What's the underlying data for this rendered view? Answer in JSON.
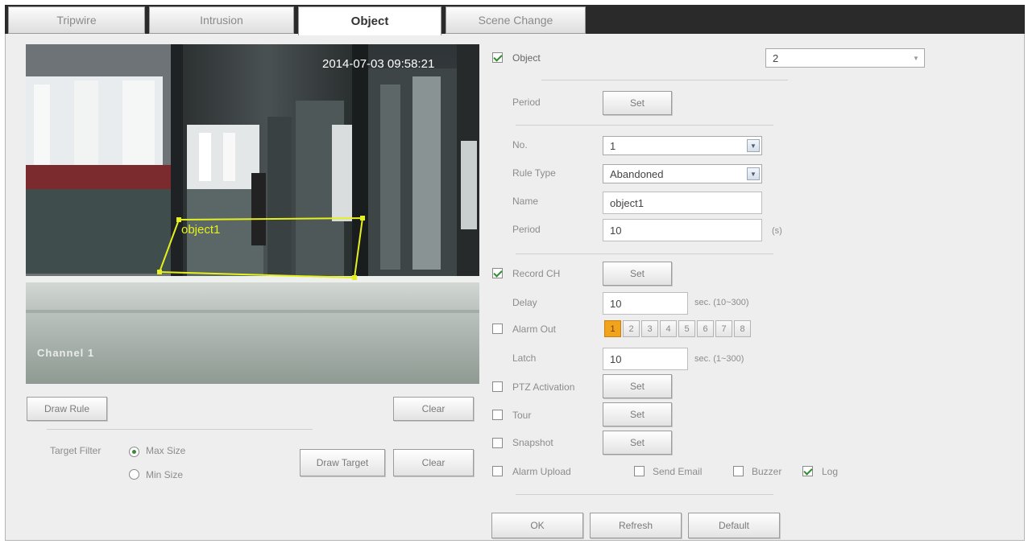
{
  "tabs": [
    {
      "label": "Tripwire"
    },
    {
      "label": "Intrusion"
    },
    {
      "label": "Object",
      "active": true
    },
    {
      "label": "Scene Change"
    }
  ],
  "video": {
    "timestamp": "2014-07-03 09:58:21",
    "channel_label": "Channel 1",
    "zone_label": "object1",
    "zone_color": "#e6f01e"
  },
  "left": {
    "draw_rule": "Draw Rule",
    "clear_1": "Clear",
    "target_filter_label": "Target Filter",
    "max_size": "Max Size",
    "min_size": "Min Size",
    "draw_target": "Draw Target",
    "clear_2": "Clear"
  },
  "right": {
    "object_enable": {
      "label": "Object",
      "checked": true
    },
    "object_count": "2",
    "period_label": "Period",
    "set": "Set",
    "no_label": "No.",
    "no_value": "1",
    "rule_type_label": "Rule Type",
    "rule_type_value": "Abandoned",
    "name_label": "Name",
    "name_value": "object1",
    "period2_label": "Period",
    "period2_value": "10",
    "period2_unit": "(s)",
    "record_ch": {
      "label": "Record CH",
      "checked": true
    },
    "delay_label": "Delay",
    "delay_value": "10",
    "delay_unit": "sec. (10~300)",
    "alarm_out": {
      "label": "Alarm Out",
      "checked": false
    },
    "alarm_channels": [
      "1",
      "2",
      "3",
      "4",
      "5",
      "6",
      "7",
      "8"
    ],
    "alarm_channel_active": "1",
    "latch_label": "Latch",
    "latch_value": "10",
    "latch_unit": "sec. (1~300)",
    "ptz": {
      "label": "PTZ Activation",
      "checked": false
    },
    "tour": {
      "label": "Tour",
      "checked": false
    },
    "snapshot": {
      "label": "Snapshot",
      "checked": false
    },
    "alarm_upload": {
      "label": "Alarm Upload",
      "checked": false
    },
    "send_email": {
      "label": "Send Email",
      "checked": false
    },
    "buzzer": {
      "label": "Buzzer",
      "checked": false
    },
    "log": {
      "label": "Log",
      "checked": true
    }
  },
  "footer": {
    "ok": "OK",
    "refresh": "Refresh",
    "default": "Default"
  }
}
